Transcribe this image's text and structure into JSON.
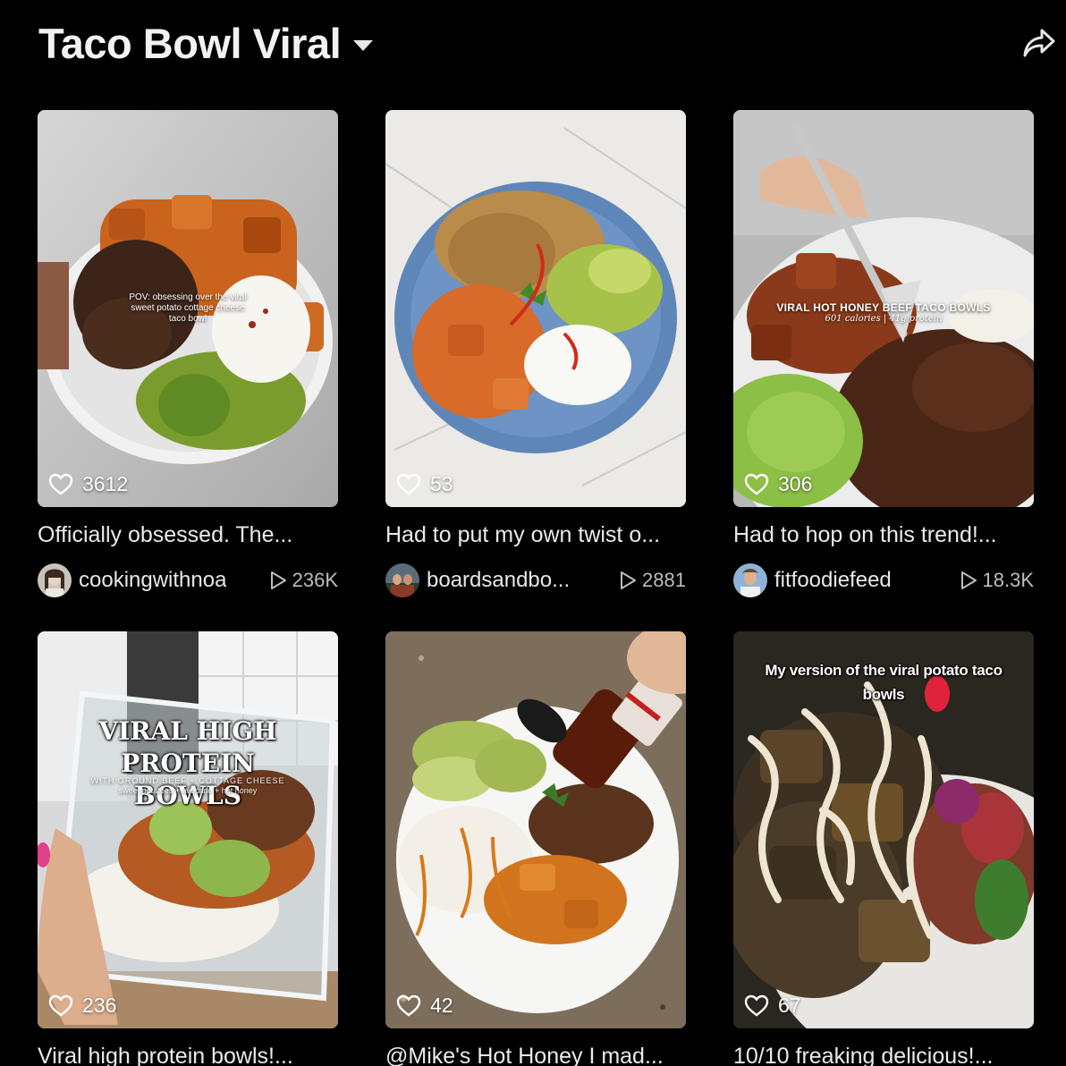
{
  "header": {
    "title": "Taco Bowl Viral",
    "dropdown_icon": "caret-down-icon",
    "share_icon": "share-arrow-icon"
  },
  "videos": [
    {
      "likes": "3612",
      "caption": "Officially obsessed. The...",
      "author": "cookingwithnoa",
      "views": "236K",
      "overlay": "POV: obsessing over the viral sweet potato cottage cheese taco bowl"
    },
    {
      "likes": "53",
      "caption": "Had to put my own twist o...",
      "author": "boardsandbo...",
      "views": "2881",
      "overlay": ""
    },
    {
      "likes": "306",
      "caption": "Had to hop on this trend!...",
      "author": "fitfoodiefeed",
      "views": "18.3K",
      "overlay": "VIRAL HOT HONEY BEEF TACO BOWLS",
      "overlay_sub": "601 calories | 41g protein"
    },
    {
      "likes": "236",
      "caption": "Viral high protein bowls!...",
      "overlay": "VIRAL HIGH PROTEIN BOWLS",
      "overlay_sub": "WITH GROUND BEEF + COTTAGE CHEESE",
      "overlay_sub2": "sweet potatoes + avocado + hot honey"
    },
    {
      "likes": "42",
      "caption": "@Mike's Hot Honey I mad...",
      "overlay": ""
    },
    {
      "likes": "67",
      "caption": "10/10 freaking delicious!...",
      "overlay": "My version of the viral potato taco bowls"
    }
  ],
  "colors": {
    "background": "#000000",
    "text_primary": "#eaeaea",
    "text_secondary": "#bdbdbd"
  }
}
